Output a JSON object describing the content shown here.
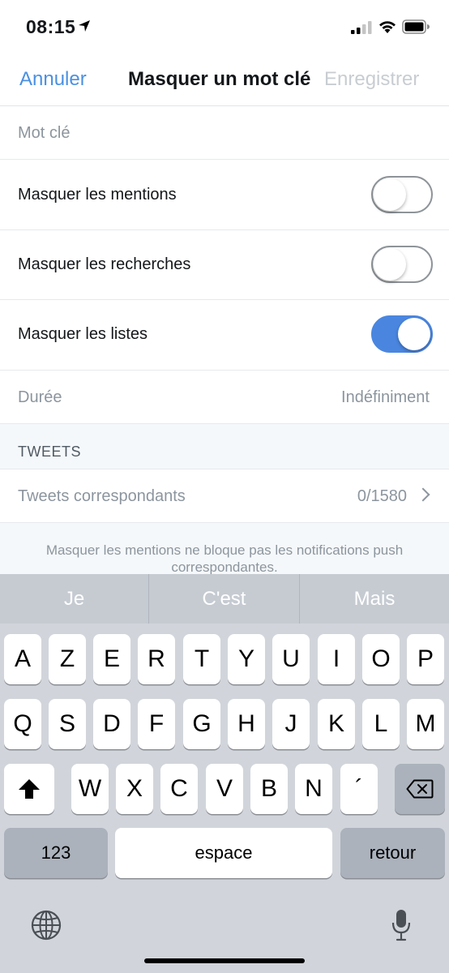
{
  "status_bar": {
    "time": "08:15",
    "icons": [
      "location-arrow-icon",
      "cellular-signal-icon",
      "wifi-icon",
      "battery-icon"
    ]
  },
  "nav": {
    "cancel_label": "Annuler",
    "title": "Masquer un mot clé",
    "save_label": "Enregistrer"
  },
  "form": {
    "keyword_placeholder": "Mot clé",
    "toggles": [
      {
        "label": "Masquer les mentions",
        "on": false
      },
      {
        "label": "Masquer les recherches",
        "on": false
      },
      {
        "label": "Masquer les listes",
        "on": true
      }
    ],
    "duration_label": "Durée",
    "duration_value": "Indéfiniment"
  },
  "tweets_section": {
    "header": "TWEETS",
    "matching_label": "Tweets correspondants",
    "matching_value": "0/1580"
  },
  "footer_note": "Masquer les mentions ne bloque pas les notifications push correspondantes.",
  "keyboard": {
    "suggestions": [
      "Je",
      "C'est",
      "Mais"
    ],
    "row1": [
      "A",
      "Z",
      "E",
      "R",
      "T",
      "Y",
      "U",
      "I",
      "O",
      "P"
    ],
    "row2": [
      "Q",
      "S",
      "D",
      "F",
      "G",
      "H",
      "J",
      "K",
      "L",
      "M"
    ],
    "row3": [
      "W",
      "X",
      "C",
      "V",
      "B",
      "N",
      "´"
    ],
    "numbers_label": "123",
    "space_label": "espace",
    "return_label": "retour"
  },
  "colors": {
    "accent": "#4a90e2",
    "toggle_on": "#4a86e0",
    "muted_text": "#8c959e"
  }
}
